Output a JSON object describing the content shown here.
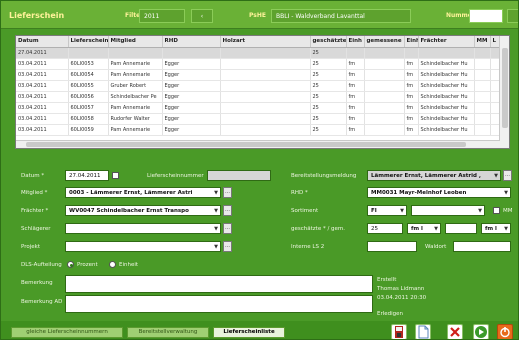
{
  "header": {
    "title": "Lieferschein",
    "filter_label": "Filter",
    "year": "2011",
    "nav_arrow": "‹",
    "pshe_label": "PsHE",
    "pshe_value": "BBLI - Waldverband Lavanttal",
    "nummer_label": "Nummer",
    "nummer_value": ""
  },
  "table": {
    "columns": [
      "Datum",
      "Lieferschein",
      "Mitglied",
      "RHD",
      "Holzart",
      "geschätzte M",
      "Einh",
      "gemessene M",
      "Einh",
      "Frächter",
      "MM",
      "L"
    ],
    "rows": [
      [
        "27.04.2011",
        "",
        "",
        "",
        "",
        "25",
        "",
        "",
        "",
        "",
        "",
        ""
      ],
      [
        "03.04.2011",
        "60LI0053",
        "Pam Annemarie",
        "Egger",
        "",
        "25",
        "fm",
        "",
        "fm",
        "Schindelbacher Hu",
        "",
        ""
      ],
      [
        "03.04.2011",
        "60LI0054",
        "Pam Annemarie",
        "Egger",
        "",
        "25",
        "fm",
        "",
        "fm",
        "Schindelbacher Hu",
        "",
        ""
      ],
      [
        "03.04.2011",
        "60LI0055",
        "Gruber Robert",
        "Egger",
        "",
        "25",
        "fm",
        "",
        "fm",
        "Schindelbacher Hu",
        "",
        ""
      ],
      [
        "03.04.2011",
        "60LI0056",
        "Schindelbacher Pe",
        "Egger",
        "",
        "25",
        "fm",
        "",
        "fm",
        "Schindelbacher Hu",
        "",
        ""
      ],
      [
        "03.04.2011",
        "60LI0057",
        "Pam Annemarie",
        "Egger",
        "",
        "25",
        "fm",
        "",
        "fm",
        "Schindelbacher Hu",
        "",
        ""
      ],
      [
        "03.04.2011",
        "60LI0058",
        "Rudorfer Walter",
        "Egger",
        "",
        "25",
        "fm",
        "",
        "fm",
        "Schindelbacher Hu",
        "",
        ""
      ],
      [
        "03.04.2011",
        "60LI0059",
        "Pam Annemarie",
        "Egger",
        "",
        "25",
        "fm",
        "",
        "fm",
        "Schindelbacher Hu",
        "",
        ""
      ]
    ]
  },
  "form": {
    "datum_label": "Datum *",
    "datum_value": "27.04.2011",
    "lsnr_label": "Lieferscheinnummer",
    "lsnr_value": "",
    "mitglied_label": "Mitglied *",
    "mitglied_value": "0003 - Lämmerer Ernst, Lämmerer Astri",
    "fraechter_label": "Frächter *",
    "fraechter_value": "WV0047 Schindelbacher Ernst Transpo",
    "schlaegerer_label": "Schlägerer",
    "schlaegerer_value": "",
    "projekt_label": "Projekt",
    "projekt_value": "",
    "dls_label": "DLS-Aufteilung",
    "dls_option_prozent": "Prozent",
    "dls_option_einheit": "Einheit",
    "bereitst_label": "Bereitstellungsmeldung",
    "bereitst_value": "Lämmerer Ernst, Lämmerer Astrid ,",
    "rhd_label": "RHD *",
    "rhd_value": "MM0031 Mayr-Melnhof Leoben",
    "sortiment_label": "Sortiment",
    "sortiment_value": "FI",
    "mm_label": "MM",
    "geschaetzt_label": "geschätzte * / gem.",
    "geschaetzt_value": "25",
    "einh1_value": "fm l",
    "einh2_value": "fm l",
    "interne_label": "Interne LS 2",
    "interne_value": "",
    "wald_label": "Waldort",
    "wald_value": "",
    "bemerkung_label": "Bemerkung",
    "bemerkung_ad_label": "Bemerkung AD",
    "erstellt_label": "Erstellt",
    "erstellt_user": "Thomas Lidmann",
    "erstellt_date": "03.04.2011 20:30",
    "erledigen_label": "Erledigen"
  },
  "bottombar": {
    "tab1": "gleiche Lieferscheinnummern",
    "tab2": "Bereitstellverwaltung",
    "tab3": "Lieferscheinliste"
  },
  "colors": {
    "background": "#4a9a27",
    "header": "#6ab136",
    "accent_text": "#fff39a"
  }
}
